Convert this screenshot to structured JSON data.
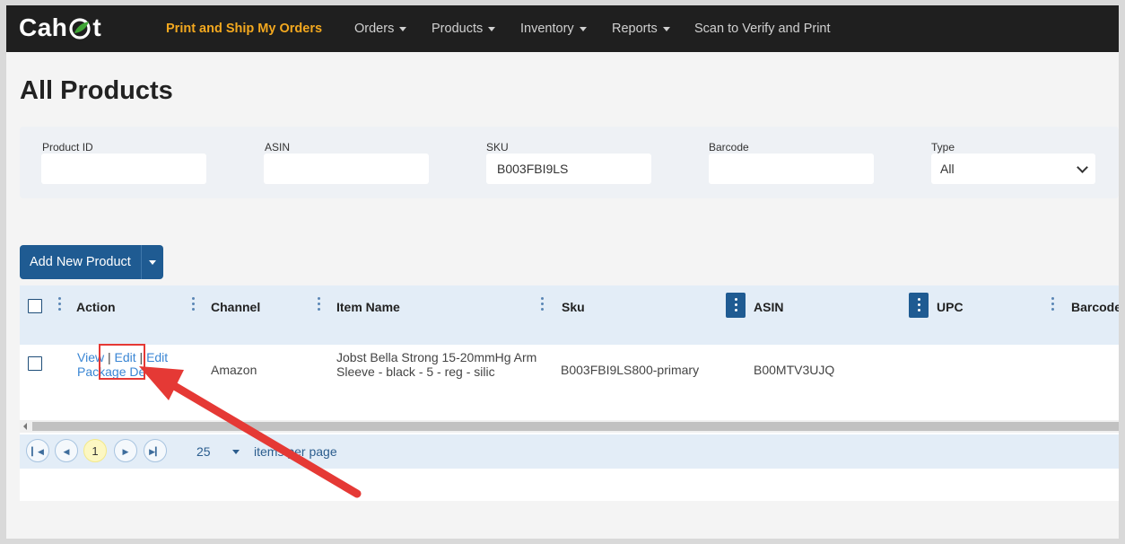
{
  "brand": {
    "name_left": "Cah",
    "name_right": "t"
  },
  "nav": {
    "items": [
      {
        "label": "Print and Ship My Orders",
        "active": true,
        "caret": false
      },
      {
        "label": "Orders",
        "active": false,
        "caret": true
      },
      {
        "label": "Products",
        "active": false,
        "caret": true
      },
      {
        "label": "Inventory",
        "active": false,
        "caret": true
      },
      {
        "label": "Reports",
        "active": false,
        "caret": true
      },
      {
        "label": "Scan to Verify and Print",
        "active": false,
        "caret": false
      }
    ]
  },
  "page": {
    "title": "All Products"
  },
  "filters": {
    "product_id": {
      "label": "Product ID",
      "value": ""
    },
    "asin": {
      "label": "ASIN",
      "value": ""
    },
    "sku": {
      "label": "SKU",
      "value": "B003FBI9LS"
    },
    "barcode": {
      "label": "Barcode",
      "value": ""
    },
    "type": {
      "label": "Type",
      "value": "All"
    }
  },
  "actions": {
    "add_product": "Add New Product"
  },
  "table": {
    "columns": [
      "Action",
      "Channel",
      "Item Name",
      "Sku",
      "ASIN",
      "UPC",
      "Barcode"
    ],
    "rows": [
      {
        "action_view": "View",
        "action_sep": "|",
        "action_edit": "Edit",
        "action_edit_package_1": "Edit",
        "action_edit_package_2": "Package De",
        "channel": "Amazon",
        "item_name_1": "Jobst Bella Strong 15-20mmHg Arm",
        "item_name_2": "Sleeve - black - 5 - reg - silic",
        "sku": "B003FBI9LS800-primary",
        "asin": "B00MTV3UJQ",
        "upc": "",
        "barcode": ""
      }
    ]
  },
  "pager": {
    "current_page": "1",
    "page_size": "25",
    "items_label": "items per page"
  },
  "colors": {
    "accent": "#1f5b92",
    "nav_bg": "#1f1f1f",
    "active_nav": "#f3a81f",
    "annotation": "#e53935"
  },
  "icons": [
    "leaf-logo-icon",
    "caret-down-icon",
    "column-menu-icon",
    "chevron-down-icon",
    "first-page-icon",
    "prev-page-icon",
    "next-page-icon",
    "last-page-icon"
  ]
}
